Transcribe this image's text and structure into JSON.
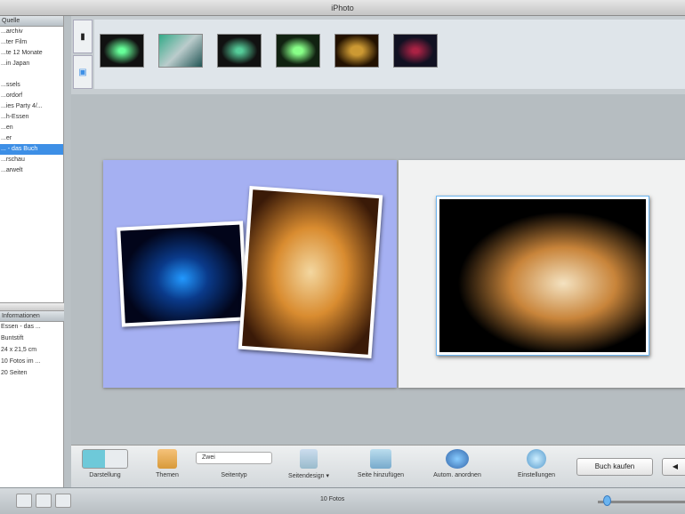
{
  "window": {
    "title": "iPhoto"
  },
  "sidebar": {
    "header": "Quelle",
    "items": [
      {
        "label": "...archiv"
      },
      {
        "label": "...ter Film"
      },
      {
        "label": "...te 12 Monate"
      },
      {
        "label": "...in Japan"
      },
      {
        "label": ""
      },
      {
        "label": "...ssels"
      },
      {
        "label": "...ordorf"
      },
      {
        "label": "...ies Party 4/..."
      },
      {
        "label": "...h-Essen"
      },
      {
        "label": "...en"
      },
      {
        "label": "...er"
      },
      {
        "label": "... - das Buch",
        "selected": true
      },
      {
        "label": "...rschau"
      },
      {
        "label": "...arwelt"
      }
    ]
  },
  "info": {
    "header": "Informationen",
    "items": [
      "Essen - das ...",
      "Buntstift",
      "24 x 21,5 cm",
      "10 Fotos im ...",
      "20 Seiten"
    ]
  },
  "toolbar": {
    "darstellung": "Darstellung",
    "themen": "Themen",
    "seitentyp_value": "Zwei",
    "seitentyp": "Seitentyp",
    "seitendesign": "Seitendesign ▾",
    "seite_hinzufuegen": "Seite hinzufügen",
    "autom_anordnen": "Autom. anordnen",
    "einstellungen": "Einstellungen",
    "buch_kaufen": "Buch kaufen"
  },
  "status": {
    "text": "10 Fotos"
  },
  "colors": {
    "accent": "#3d8fe6",
    "page_left": "#a5b0f2"
  }
}
